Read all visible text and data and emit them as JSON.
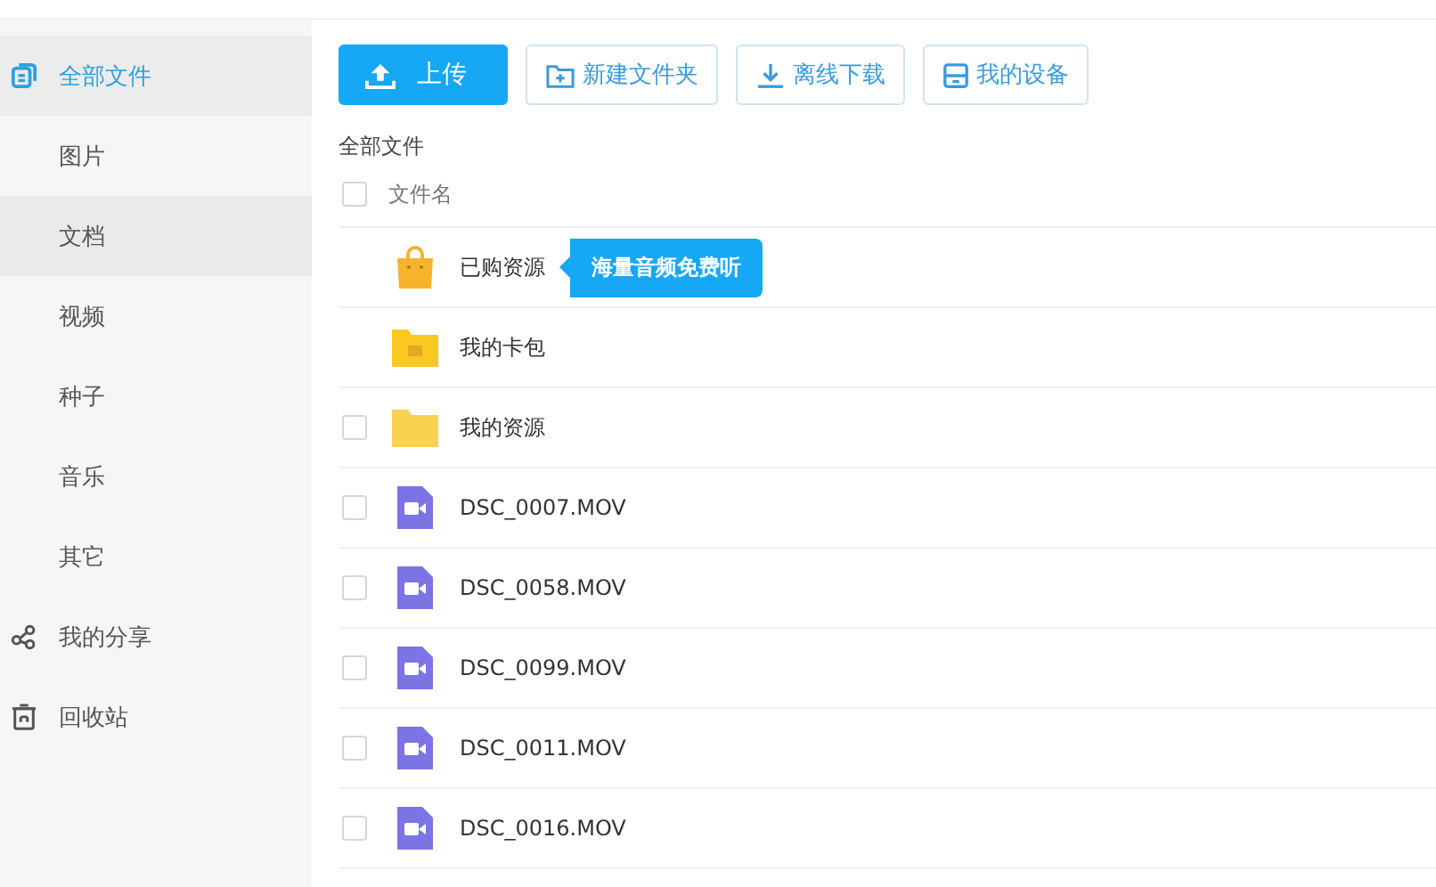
{
  "sidebar": {
    "items": [
      {
        "label": "全部文件",
        "kind": "files",
        "selected": true,
        "highlighted": false
      },
      {
        "label": "图片",
        "kind": "sub",
        "selected": false,
        "highlighted": false
      },
      {
        "label": "文档",
        "kind": "sub",
        "selected": false,
        "highlighted": true
      },
      {
        "label": "视频",
        "kind": "sub",
        "selected": false,
        "highlighted": false
      },
      {
        "label": "种子",
        "kind": "sub",
        "selected": false,
        "highlighted": false
      },
      {
        "label": "音乐",
        "kind": "sub",
        "selected": false,
        "highlighted": false
      },
      {
        "label": "其它",
        "kind": "sub",
        "selected": false,
        "highlighted": false
      },
      {
        "label": "我的分享",
        "kind": "share",
        "selected": false,
        "highlighted": false
      },
      {
        "label": "回收站",
        "kind": "trash",
        "selected": false,
        "highlighted": false
      }
    ]
  },
  "toolbar": [
    {
      "label": "上传",
      "kind": "upload"
    },
    {
      "label": "新建文件夹",
      "kind": "newfolder"
    },
    {
      "label": "离线下载",
      "kind": "download"
    },
    {
      "label": "我的设备",
      "kind": "device"
    }
  ],
  "breadcrumb": "全部文件",
  "table": {
    "header": {
      "label": "文件名",
      "checked": false
    },
    "rows": [
      {
        "name": "已购资源",
        "kind": "bag",
        "tooltip": "海量音频免费听"
      },
      {
        "name": "我的卡包",
        "kind": "wallet"
      },
      {
        "name": "我的资源",
        "kind": "folder",
        "checked": false
      },
      {
        "name": "DSC_0007.MOV",
        "kind": "video",
        "checked": false
      },
      {
        "name": "DSC_0058.MOV",
        "kind": "video",
        "checked": false
      },
      {
        "name": "DSC_0099.MOV",
        "kind": "video",
        "checked": false
      },
      {
        "name": "DSC_0011.MOV",
        "kind": "video",
        "checked": false
      },
      {
        "name": "DSC_0016.MOV",
        "kind": "video",
        "checked": false
      }
    ]
  }
}
